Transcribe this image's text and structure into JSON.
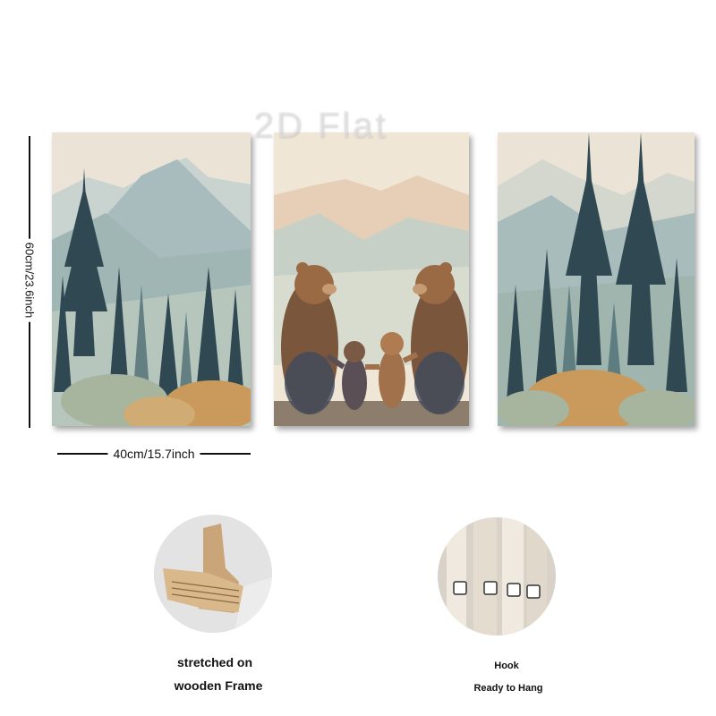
{
  "watermark": "2D Flat",
  "dimensions": {
    "height_label": "60cm/23.6inch",
    "width_label": "40cm/15.7inch"
  },
  "panels": [
    {
      "name": "left",
      "scene": "mountains-pine-forest"
    },
    {
      "name": "center",
      "scene": "bear-family-mountains"
    },
    {
      "name": "right",
      "scene": "pine-forest-mountains"
    }
  ],
  "details": {
    "frame": {
      "line1": "stretched on",
      "line2": "wooden Frame"
    },
    "hook": {
      "line1": "Hook",
      "line2": "Ready to Hang"
    }
  },
  "colors": {
    "sky": "#ece5d8",
    "mountain": "#aebfc0",
    "pine": "#3f5a63",
    "bush": "#c99a5c",
    "bear": "#8a5a3a",
    "wood": "#c9a579"
  }
}
